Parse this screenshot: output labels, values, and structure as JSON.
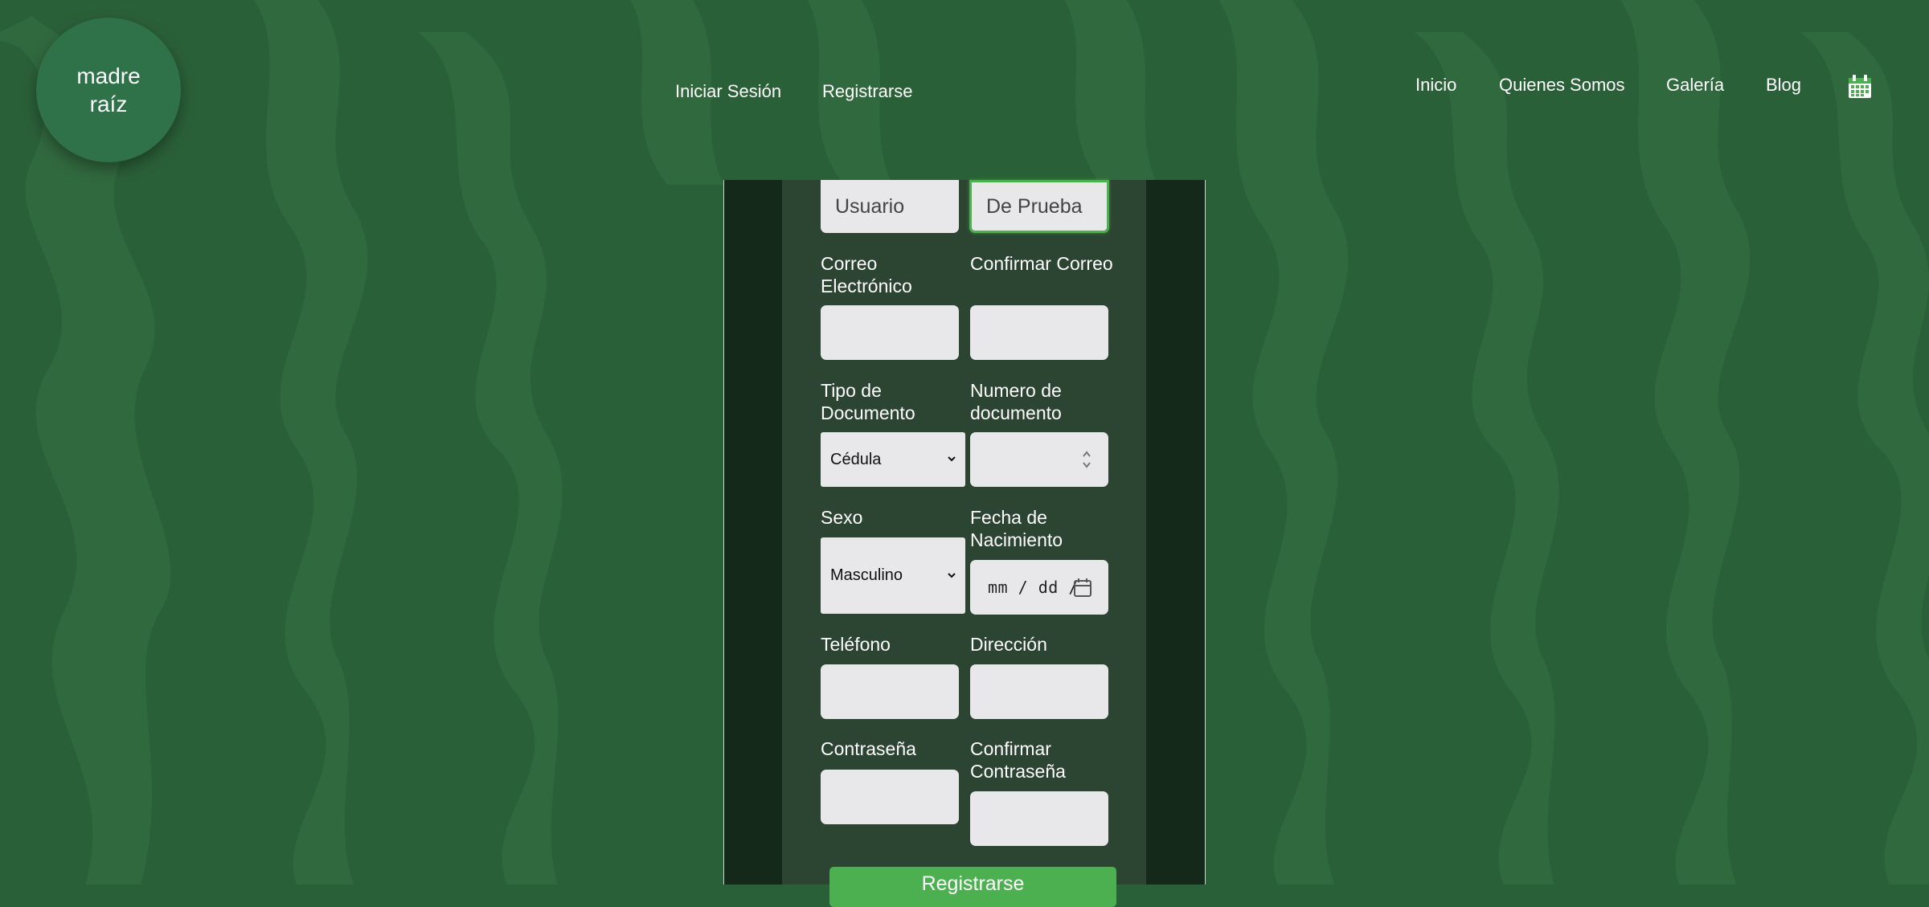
{
  "logo": {
    "line1": "madre",
    "line2": "raíz"
  },
  "auth_nav": {
    "login": "Iniciar Sesión",
    "register": "Registrarse"
  },
  "main_nav": {
    "home": "Inicio",
    "about": "Quienes Somos",
    "gallery": "Galería",
    "blog": "Blog"
  },
  "form": {
    "first_name_value": "Usuario",
    "last_name_value": "De Prueba",
    "email_label": "Correo Electrónico",
    "confirm_email_label": "Confirmar Correo",
    "doc_type_label": "Tipo de Documento",
    "doc_type_selected": "Cédula",
    "doc_number_label": "Numero de documento",
    "sex_label": "Sexo",
    "sex_selected": "Masculino",
    "birthdate_label": "Fecha de Nacimiento",
    "birthdate_placeholder": "mm / dd /",
    "phone_label": "Teléfono",
    "address_label": "Dirección",
    "password_label": "Contraseña",
    "confirm_password_label": "Confirmar Contraseña",
    "submit_label": "Registrarse"
  },
  "colors": {
    "background": "#2a6038",
    "logo_circle": "#2f7249",
    "panel_outer": "#15291b",
    "panel_inner": "#2c4532",
    "accent": "#4caf50"
  }
}
